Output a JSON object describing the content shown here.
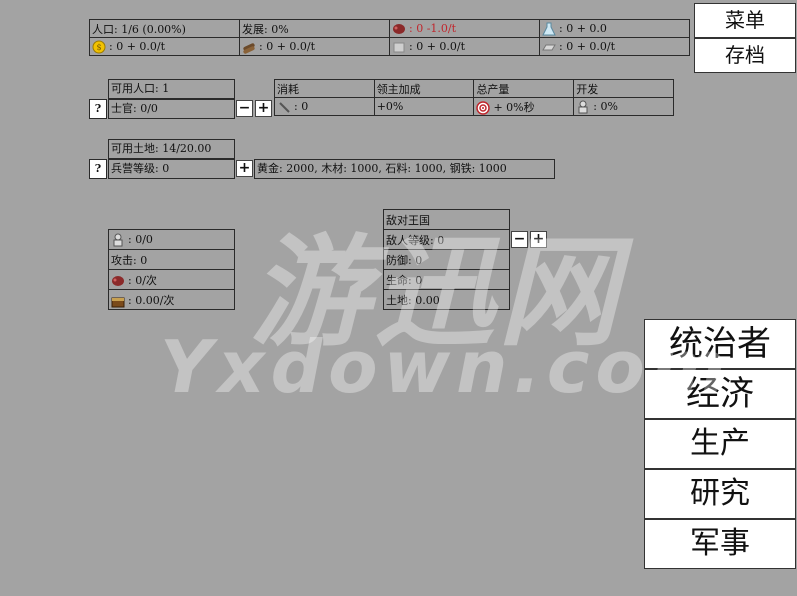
{
  "resources": {
    "row1": [
      {
        "icon": "population-icon",
        "text": "人口: 1/6 (0.00%)",
        "red": false
      },
      {
        "icon": "development-icon",
        "text": "发展: 0%",
        "red": false
      },
      {
        "icon": "meat-icon",
        "text": ": 0 -1.0/t",
        "red": true
      },
      {
        "icon": "flask-icon",
        "text": ": 0 + 0.0",
        "red": false
      }
    ],
    "row2": [
      {
        "icon": "coin-icon",
        "text": ": 0 + 0.0/t",
        "red": false
      },
      {
        "icon": "wood-icon",
        "text": ": 0 + 0.0/t",
        "red": false
      },
      {
        "icon": "stone-icon",
        "text": ": 0 + 0.0/t",
        "red": false
      },
      {
        "icon": "iron-icon",
        "text": ": 0 + 0.0/t",
        "red": false
      }
    ]
  },
  "top_menu": {
    "menu_label": "菜单",
    "save_label": "存档"
  },
  "officers": {
    "available_pop": "可用人口: 1",
    "officer": "士官: 0/0",
    "help": "?",
    "minus": "−",
    "plus": "+"
  },
  "production": {
    "headers": [
      "消耗",
      "领主加成",
      "总产量",
      "开发"
    ],
    "values": [
      ": 0",
      "+0%",
      "+ 0%秒",
      ": 0%"
    ]
  },
  "barracks": {
    "available_land": "可用土地: 14/20.00",
    "level": "兵营等级: 0",
    "help": "?",
    "plus": "+",
    "cost": "黄金: 2000, 木材: 1000, 石料: 1000, 钢铁: 1000"
  },
  "army": {
    "soldiers": ": 0/0",
    "attack": "攻击: 0",
    "meat": ": 0/次",
    "gold": ": 0.00/次"
  },
  "enemy": {
    "title": "敌对王国",
    "level": "敌人等级: 0",
    "defense": "防御: 0",
    "life": "生命: 0",
    "land": "土地: 0.00",
    "minus": "−",
    "plus": "+"
  },
  "nav": [
    "统治者",
    "经济",
    "生产",
    "研究",
    "军事"
  ],
  "watermark": {
    "top": "游迅网",
    "bottom": "Yxdown.com"
  },
  "colors": {
    "background": "#a3a3a3",
    "red_text": "#c0272d"
  }
}
